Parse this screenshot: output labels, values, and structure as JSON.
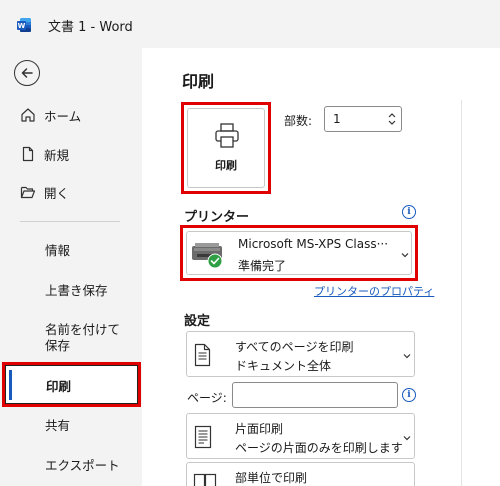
{
  "titlebar": {
    "title": "文書 1  -  Word",
    "app_icon": "word-icon"
  },
  "sidebar": {
    "items": [
      {
        "label": "ホーム",
        "icon": "home-icon"
      },
      {
        "label": "新規",
        "icon": "new-doc-icon"
      },
      {
        "label": "開く",
        "icon": "folder-open-icon"
      },
      {
        "label": "情報"
      },
      {
        "label": "上書き保存"
      },
      {
        "label": "名前を付けて保存"
      },
      {
        "label": "印刷"
      },
      {
        "label": "共有"
      },
      {
        "label": "エクスポート"
      }
    ]
  },
  "main": {
    "title": "印刷",
    "print_button": "印刷",
    "copies": {
      "label": "部数:",
      "value": "1"
    },
    "printer": {
      "section_title": "プリンター",
      "name": "Microsoft MS-XPS Class···",
      "status": "準備完了",
      "properties_link": "プリンターのプロパティ"
    },
    "settings": {
      "section_title": "設定",
      "range": {
        "line1": "すべてのページを印刷",
        "line2": "ドキュメント全体"
      },
      "pages_label": "ページ:",
      "sides": {
        "line1": "片面印刷",
        "line2": "ページの片面のみを印刷します"
      },
      "collate": {
        "line1": "部単位で印刷"
      }
    }
  },
  "colors": {
    "accent": "#185abd",
    "highlight": "#e00000",
    "sidebar_bg": "#f3f3f3"
  }
}
